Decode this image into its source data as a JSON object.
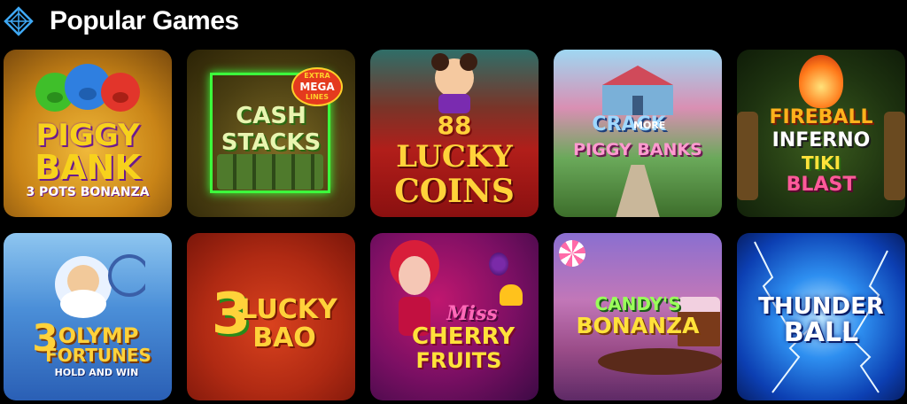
{
  "header": {
    "title": "Popular Games",
    "logo_icon": "diamond-icon"
  },
  "games": [
    {
      "line1": "PIGGY",
      "line2": "BANK",
      "line3": "3 POTS BONANZA"
    },
    {
      "line1": "CASH",
      "line2": "STACKS",
      "badge1": "EXTRA",
      "badge2": "MEGA",
      "badge3": "LINES"
    },
    {
      "line1": "88",
      "line2": "LUCKY",
      "line3": "COINS"
    },
    {
      "line1": "CRACK",
      "line2": "MORE",
      "line3": "PIGGY BANKS"
    },
    {
      "line1": "FIREBALL",
      "line2": "INFERNO",
      "line3": "TIKI",
      "line4": "BLAST"
    },
    {
      "line1": "3",
      "line2": "OLYMP",
      "line3": "FORTUNES",
      "line4": "HOLD AND WIN"
    },
    {
      "line1": "3",
      "line2": "LUCKY",
      "line3": "BAO"
    },
    {
      "line1": "Miss",
      "line2": "CHERRY",
      "line3": "FRUITS"
    },
    {
      "line1": "CANDY'S",
      "line2": "BONANZA"
    },
    {
      "line1": "THUNDER",
      "line2": "BALL"
    }
  ],
  "colors": {
    "background": "#000000",
    "title_text": "#ffffff",
    "logo_stroke": "#3fa9f5"
  }
}
